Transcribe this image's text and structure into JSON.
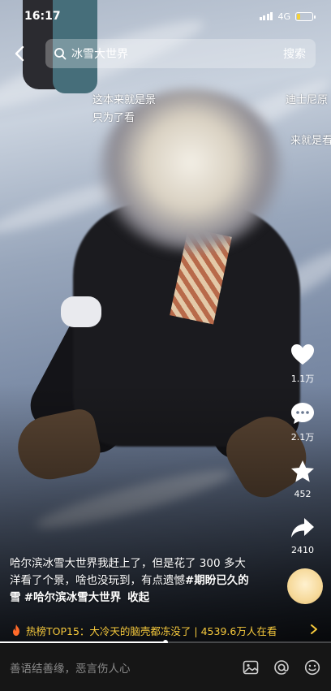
{
  "status_bar": {
    "time": "16:17",
    "network": "4G",
    "battery_level": 0.2
  },
  "search": {
    "query": "冰雪大世界",
    "submit_label": "搜索"
  },
  "danmaku": [
    "这本来就是景",
    "只为了看",
    "迪士尼原",
    "来就是看"
  ],
  "actions": {
    "like_count": "1.1万",
    "comment_count": "2.1万",
    "favorite_count": "452",
    "share_count": "2410"
  },
  "caption": {
    "text": "哈尔滨冰雪大世界我赶上了，但是花了 300 多大洋看了个景，啥也没玩到，有点遗憾",
    "tag1": "#期盼已久的雪",
    "tag2": "#哈尔滨冰雪大世界",
    "fold_label": "收起"
  },
  "hot_banner": {
    "title": "热榜TOP15：大冷天的脑壳都冻没了",
    "count": "| 4539.6万人在看"
  },
  "progress": {
    "played_fraction": 0.5
  },
  "comment_bar": {
    "placeholder": "善语结善缘，恶言伤人心"
  },
  "colors": {
    "accent": "#f6c93c",
    "battery": "#f3d13a",
    "bar_bg": "#161616"
  }
}
